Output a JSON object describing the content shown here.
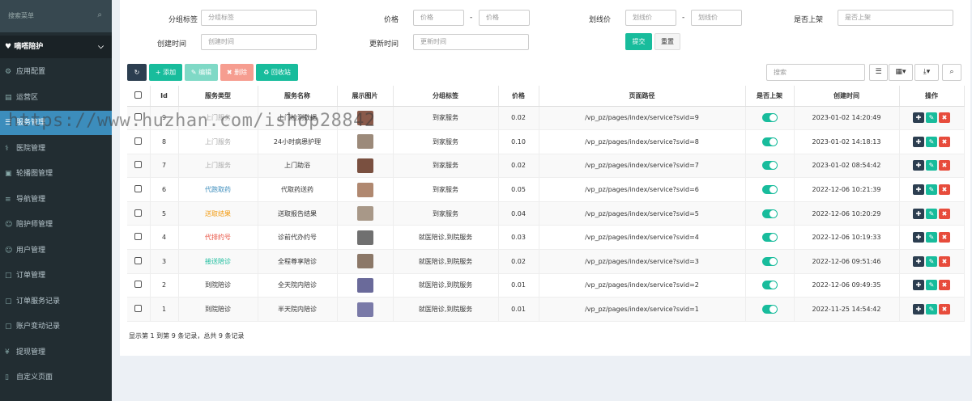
{
  "sidebar": {
    "search_placeholder": "搜索菜单",
    "group": "嘀嗒陪护",
    "items": [
      {
        "label": "应用配置",
        "icon": "gear-icon"
      },
      {
        "label": "运营区",
        "icon": "map-icon"
      },
      {
        "label": "服务管理",
        "icon": "list-icon",
        "active": true
      },
      {
        "label": "医院管理",
        "icon": "hospital-icon"
      },
      {
        "label": "轮播图管理",
        "icon": "image-icon"
      },
      {
        "label": "导航管理",
        "icon": "nav-icon"
      },
      {
        "label": "陪护师管理",
        "icon": "user-icon"
      },
      {
        "label": "用户管理",
        "icon": "user-icon"
      },
      {
        "label": "订单管理",
        "icon": "order-icon"
      },
      {
        "label": "订单服务记录",
        "icon": "record-icon"
      },
      {
        "label": "账户变动记录",
        "icon": "record-icon"
      },
      {
        "label": "提现管理",
        "icon": "yen-icon"
      },
      {
        "label": "自定义页面",
        "icon": "file-icon"
      }
    ]
  },
  "filters": {
    "tag_label": "分组标签",
    "tag_placeholder": "分组标签",
    "price_label": "价格",
    "price_min_placeholder": "价格",
    "price_max_placeholder": "价格",
    "line_price_label": "划线价",
    "line_price_min_placeholder": "划线价",
    "line_price_max_placeholder": "划线价",
    "on_shelf_label": "是否上架",
    "on_shelf_placeholder": "是否上架",
    "created_label": "创建时间",
    "created_placeholder": "创建时间",
    "updated_label": "更新时间",
    "updated_placeholder": "更新时间",
    "dash": "-",
    "submit": "提交",
    "reset": "重置"
  },
  "toolbar": {
    "add": "添加",
    "edit": "编辑",
    "delete": "删除",
    "recycle": "回收站",
    "search_placeholder": "搜索"
  },
  "table": {
    "headers": [
      "",
      "Id",
      "服务类型",
      "服务名称",
      "展示图片",
      "分组标签",
      "价格",
      "页面路径",
      "是否上架",
      "创建时间",
      "操作"
    ],
    "rows": [
      {
        "id": "9",
        "type": "上门服务",
        "type_color": "#aaaaaa",
        "name": "上门检测数据",
        "tag": "到家服务",
        "price": "0.02",
        "path": "/vp_pz/pages/index/service?svid=9",
        "created": "2023-01-02 14:20:49",
        "thumb": "#8a5a4a"
      },
      {
        "id": "8",
        "type": "上门服务",
        "type_color": "#aaaaaa",
        "name": "24小时病患护理",
        "tag": "到家服务",
        "price": "0.10",
        "path": "/vp_pz/pages/index/service?svid=8",
        "created": "2023-01-02 14:18:13",
        "thumb": "#9c8a7a"
      },
      {
        "id": "7",
        "type": "上门服务",
        "type_color": "#aaaaaa",
        "name": "上门助浴",
        "tag": "到家服务",
        "price": "0.02",
        "path": "/vp_pz/pages/index/service?svid=7",
        "created": "2023-01-02 08:54:42",
        "thumb": "#7a5040"
      },
      {
        "id": "6",
        "type": "代跑取药",
        "type_color": "#3c8dbc",
        "name": "代取药送药",
        "tag": "到家服务",
        "price": "0.05",
        "path": "/vp_pz/pages/index/service?svid=6",
        "created": "2022-12-06 10:21:39",
        "thumb": "#b08870"
      },
      {
        "id": "5",
        "type": "送取结果",
        "type_color": "#f39c12",
        "name": "送取报告结果",
        "tag": "到家服务",
        "price": "0.04",
        "path": "/vp_pz/pages/index/service?svid=5",
        "created": "2022-12-06 10:20:29",
        "thumb": "#a89888"
      },
      {
        "id": "4",
        "type": "代排约号",
        "type_color": "#e74c3c",
        "name": "诊前代办约号",
        "tag": "就医陪诊,到院服务",
        "price": "0.03",
        "path": "/vp_pz/pages/index/service?svid=4",
        "created": "2022-12-06 10:19:33",
        "thumb": "#707070"
      },
      {
        "id": "3",
        "type": "接送陪诊",
        "type_color": "#18bc9c",
        "name": "全程尊享陪诊",
        "tag": "就医陪诊,到院服务",
        "price": "0.02",
        "path": "/vp_pz/pages/index/service?svid=3",
        "created": "2022-12-06 09:51:46",
        "thumb": "#8c7868"
      },
      {
        "id": "2",
        "type": "到院陪诊",
        "type_color": "#333333",
        "name": "全天院内陪诊",
        "tag": "就医陪诊,到院服务",
        "price": "0.01",
        "path": "/vp_pz/pages/index/service?svid=2",
        "created": "2022-12-06 09:49:35",
        "thumb": "#6a6a9a"
      },
      {
        "id": "1",
        "type": "到院陪诊",
        "type_color": "#333333",
        "name": "半天院内陪诊",
        "tag": "就医陪诊,到院服务",
        "price": "0.01",
        "path": "/vp_pz/pages/index/service?svid=1",
        "created": "2022-11-25 14:54:42",
        "thumb": "#7a7aa8"
      }
    ]
  },
  "pager": "显示第 1 到第 9 条记录，总共 9 条记录",
  "watermark": "https://www.huzhan.com/ishop28842"
}
